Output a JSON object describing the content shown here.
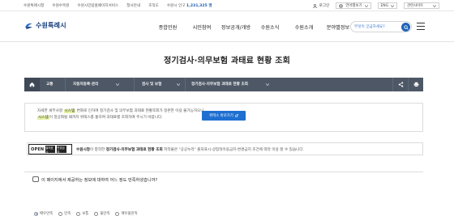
{
  "topbar": {
    "links": [
      "수원특례시청",
      "수원수목원",
      "수원시민탐홈페이지서비스",
      "청사안내",
      "조직도"
    ],
    "population_label": "수원시 인구",
    "population_value": "1,231,325 명",
    "login": "로그인",
    "language": "언어별보기",
    "language_code": "ENG",
    "related": "관련사이트"
  },
  "header": {
    "logo": "수원특례시",
    "menu": [
      "종합민원",
      "시민참여",
      "정보공개/개방",
      "수원소식",
      "수원소개",
      "분야별정보"
    ],
    "search_placeholder": "무엇이 궁금하세요?"
  },
  "page": {
    "title": "정기검사·의무보험 과태료 현황 조회"
  },
  "breadcrumb": {
    "home": "홈",
    "items": [
      "교통",
      "자동차등록·관리",
      "검사 및 보험",
      "정기검사·의무보험 과태료 현황 조회"
    ]
  },
  "notice": {
    "line1_pre": "자세한 세부사항",
    "line1_highlight": "시스템",
    "line1_post": "변화로 인하여 정기검사 및 의무보험 과태료 현황조회가 정본한 이용 불가능하오니",
    "line2_highlight": "시스템",
    "line2_post": "이 정상화될 때까지 위택스를 통하여 과태료를 조회하여 주시기 바랍니다.",
    "button": "위택스 바로가기"
  },
  "license": {
    "open_label": "OPEN",
    "badge_1": "출처표시",
    "badge_2": "변경금지",
    "text_pre": "수원시청",
    "text_mid": "이 창작한",
    "text_bold": "정기검사·의무보험 과태료 현황 조회",
    "text_post": "저작물은 \"공공누리\" 출처표시-상업적이용금지-변경금지 조건에 따라 이용 할 수 있습니다."
  },
  "survey": {
    "question": "이 페이지에서 제공하는 정보에 대하여 어느 정도 만족하셨습니까?",
    "options": [
      "매우만족",
      "만족",
      "보통",
      "불만족",
      "매우불만족"
    ],
    "selected": "매우만족"
  },
  "colors": {
    "accent": "#1f6fd1",
    "breadcrumb_bg": "#4d5766",
    "highlight": "#e7f2a6",
    "logo": "#163f7d"
  }
}
